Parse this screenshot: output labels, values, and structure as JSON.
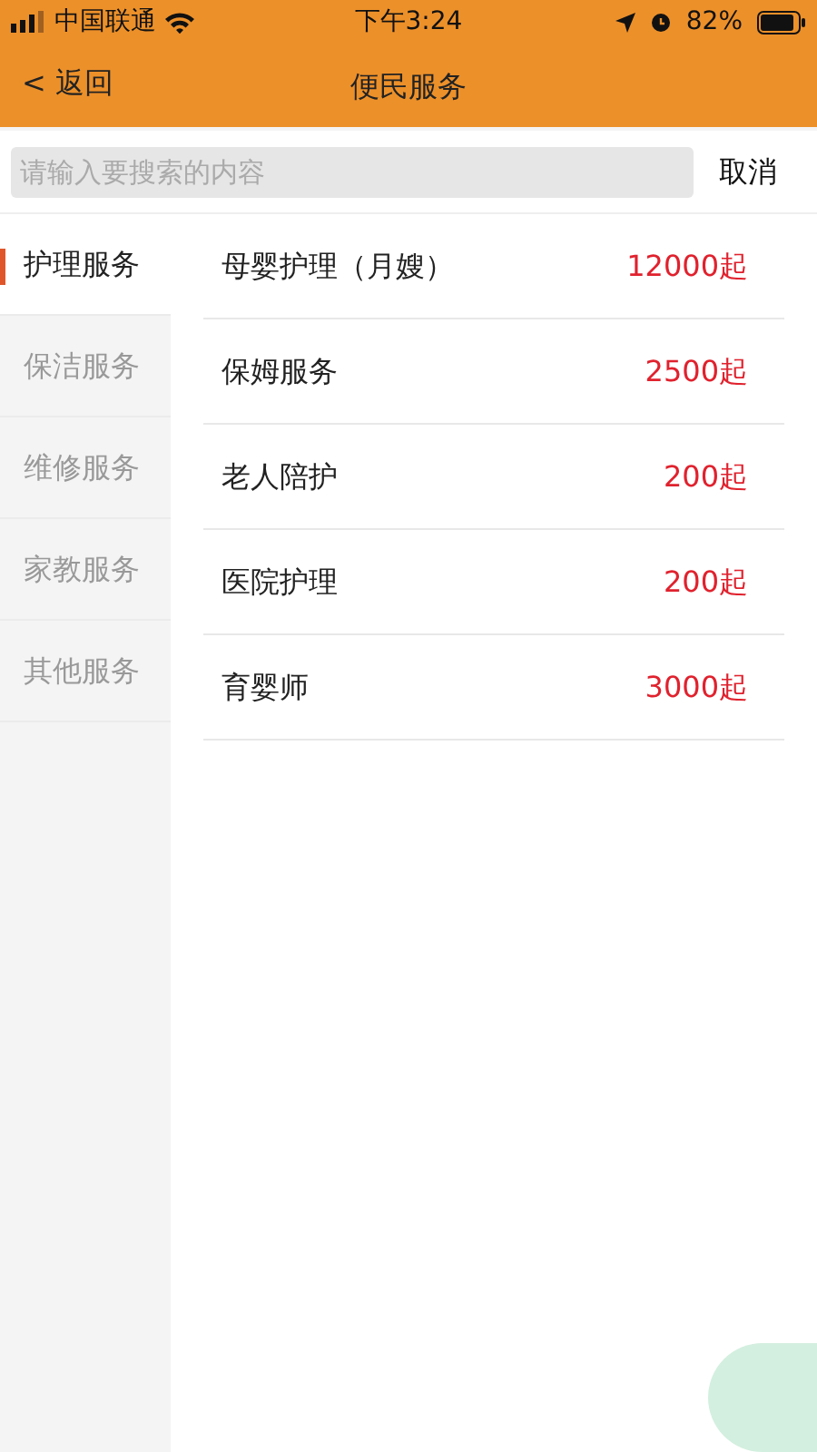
{
  "status_bar": {
    "carrier": "中国联通",
    "time": "下午3:24",
    "battery": "82%"
  },
  "nav": {
    "back": "< 返回",
    "title": "便民服务"
  },
  "search": {
    "placeholder": "请输入要搜索的内容",
    "cancel": "取消"
  },
  "categories": [
    {
      "label": "护理服务",
      "selected": true
    },
    {
      "label": "保洁服务",
      "selected": false
    },
    {
      "label": "维修服务",
      "selected": false
    },
    {
      "label": "家教服务",
      "selected": false
    },
    {
      "label": "其他服务",
      "selected": false
    }
  ],
  "services": [
    {
      "name": "母婴护理（月嫂）",
      "price": "12000起"
    },
    {
      "name": "保姆服务",
      "price": "2500起"
    },
    {
      "name": "老人陪护",
      "price": "200起"
    },
    {
      "name": "医院护理",
      "price": "200起"
    },
    {
      "name": "育婴师",
      "price": "3000起"
    }
  ]
}
